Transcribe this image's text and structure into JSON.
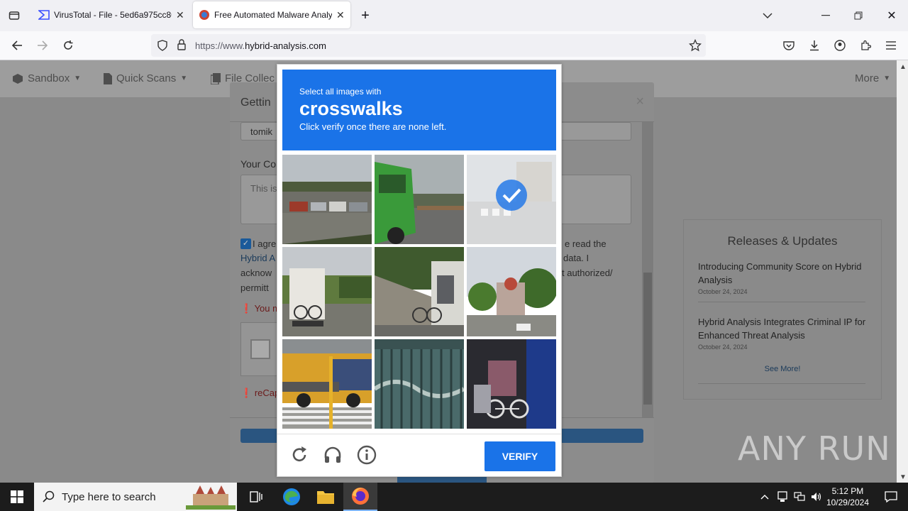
{
  "browser": {
    "tabs": [
      {
        "title": "VirusTotal - File - 5ed6a975cc80",
        "active": false
      },
      {
        "title": "Free Automated Malware Analy",
        "active": true
      }
    ],
    "url_prefix": "https://www.",
    "url_domain": "hybrid-analysis.com"
  },
  "site_nav": {
    "sandbox": "Sandbox",
    "quick_scans": "Quick Scans",
    "file_collections": "File Collec",
    "more": "More"
  },
  "modal": {
    "title": "Gettin",
    "username_value": "tomik",
    "comment_label": "Your Co",
    "comment_placeholder": "This is",
    "agree_start": "I agre",
    "agree_link": "Hybrid A",
    "agree_line3": "acknow",
    "agree_line4": "permitt",
    "agree_right1": "e read the",
    "agree_right2": "data. I",
    "agree_right3": "t authorized/",
    "error_must": "You m",
    "error_recaptcha": "reCap"
  },
  "releases": {
    "title": "Releases & Updates",
    "items": [
      {
        "title": "Introducing Community Score on Hybrid Analysis",
        "date": "October 24, 2024"
      },
      {
        "title": "Hybrid Analysis Integrates Criminal IP for Enhanced Threat Analysis",
        "date": "October 24, 2024"
      }
    ],
    "see_more": "See More!"
  },
  "captcha": {
    "instruction": "Select all images with",
    "target": "crosswalks",
    "hint": "Click verify once there are none left.",
    "verify_label": "VERIFY",
    "tiles": [
      {
        "scene": "parking-lot",
        "selected": false
      },
      {
        "scene": "green-truck",
        "selected": false
      },
      {
        "scene": "street-crosswalk",
        "selected": true
      },
      {
        "scene": "camper-van",
        "selected": false
      },
      {
        "scene": "bicycle-wall",
        "selected": false
      },
      {
        "scene": "street-trees",
        "selected": false
      },
      {
        "scene": "yellow-truck-crosswalk",
        "selected": false
      },
      {
        "scene": "green-fence",
        "selected": false
      },
      {
        "scene": "bicycles-shop",
        "selected": false
      }
    ]
  },
  "taskbar": {
    "search_placeholder": "Type here to search",
    "time": "5:12 PM",
    "date": "10/29/2024"
  },
  "watermark": "ANY RUN",
  "colors": {
    "accent": "#1a73e8",
    "browser_bg": "#f0f0f4",
    "taskbar": "#1c1c1c"
  }
}
